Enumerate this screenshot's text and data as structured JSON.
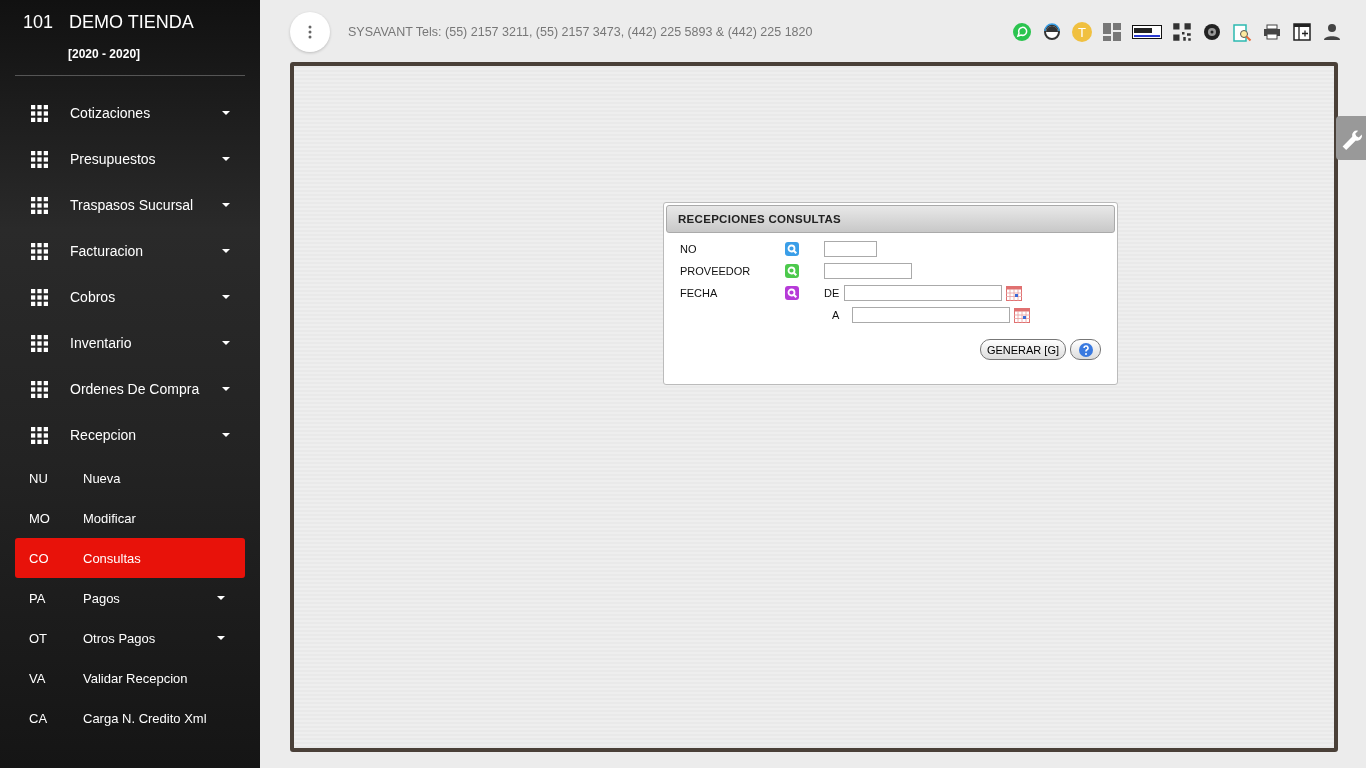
{
  "store": {
    "number": "101",
    "name": "DEMO TIENDA",
    "period": "[2020 - 2020]"
  },
  "menu": [
    {
      "label": "Cotizaciones",
      "expandable": true
    },
    {
      "label": "Presupuestos",
      "expandable": true
    },
    {
      "label": "Traspasos Sucursal",
      "expandable": true
    },
    {
      "label": "Facturacion",
      "expandable": true
    },
    {
      "label": "Cobros",
      "expandable": true
    },
    {
      "label": "Inventario",
      "expandable": true
    },
    {
      "label": "Ordenes De Compra",
      "expandable": true
    },
    {
      "label": "Recepcion",
      "expandable": true,
      "children": [
        {
          "abbr": "NU",
          "label": "Nueva",
          "selected": false,
          "expandable": false
        },
        {
          "abbr": "MO",
          "label": "Modificar",
          "selected": false,
          "expandable": false
        },
        {
          "abbr": "CO",
          "label": "Consultas",
          "selected": true,
          "expandable": false
        },
        {
          "abbr": "PA",
          "label": "Pagos",
          "selected": false,
          "expandable": true
        },
        {
          "abbr": "OT",
          "label": "Otros Pagos",
          "selected": false,
          "expandable": true
        },
        {
          "abbr": "VA",
          "label": "Validar Recepcion",
          "selected": false,
          "expandable": false
        },
        {
          "abbr": "CA",
          "label": "Carga N. Credito Xml",
          "selected": false,
          "expandable": false
        }
      ]
    }
  ],
  "header": {
    "contact": "SYSAVANT Tels: (55) 2157 3211, (55) 2157 3473, (442) 225 5893 & (442) 225 1820",
    "toolbar": [
      {
        "kind": "chat"
      },
      {
        "kind": "support"
      },
      {
        "kind": "letter",
        "text": "T"
      },
      {
        "kind": "tiles"
      },
      {
        "kind": "xml"
      },
      {
        "kind": "qr"
      },
      {
        "kind": "tire"
      },
      {
        "kind": "clipboard"
      },
      {
        "kind": "printer"
      },
      {
        "kind": "add-table"
      },
      {
        "kind": "user"
      }
    ]
  },
  "dialog": {
    "title": "RECEPCIONES CONSULTAS",
    "fields": [
      {
        "label": "NO",
        "color": "#3a9ee8",
        "kind": "short"
      },
      {
        "label": "PROVEEDOR",
        "color": "#4cc94c",
        "kind": "medium"
      },
      {
        "label": "FECHA",
        "color": "#b63ad8",
        "kind": "range",
        "from_label": "DE",
        "to_label": "A"
      }
    ],
    "generate_button": "GENERAR [G]"
  }
}
